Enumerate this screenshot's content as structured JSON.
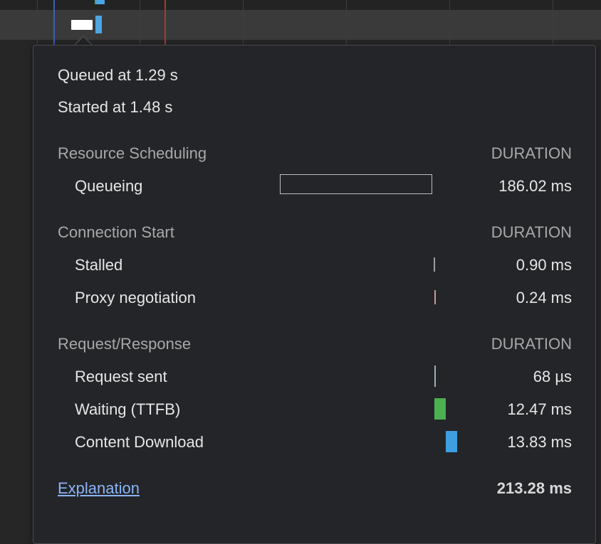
{
  "timing": {
    "queued_at": "Queued at 1.29 s",
    "started_at": "Started at 1.48 s",
    "sections": [
      {
        "title": "Resource Scheduling",
        "duration_label": "DURATION",
        "rows": [
          {
            "label": "Queueing",
            "value": "186.02 ms"
          }
        ]
      },
      {
        "title": "Connection Start",
        "duration_label": "DURATION",
        "rows": [
          {
            "label": "Stalled",
            "value": "0.90 ms"
          },
          {
            "label": "Proxy negotiation",
            "value": "0.24 ms"
          }
        ]
      },
      {
        "title": "Request/Response",
        "duration_label": "DURATION",
        "rows": [
          {
            "label": "Request sent",
            "value": "68 µs"
          },
          {
            "label": "Waiting (TTFB)",
            "value": "12.47 ms"
          },
          {
            "label": "Content Download",
            "value": "13.83 ms"
          }
        ]
      }
    ],
    "explanation_link": "Explanation",
    "total": "213.28 ms"
  },
  "colors": {
    "queueing": "#bdbdbd",
    "stalled": "#9e9e9e",
    "proxy": "#c49a9a",
    "request_sent": "#9ab0b8",
    "waiting": "#4caf50",
    "download": "#3d9ee0",
    "link": "#8ab4f8"
  }
}
